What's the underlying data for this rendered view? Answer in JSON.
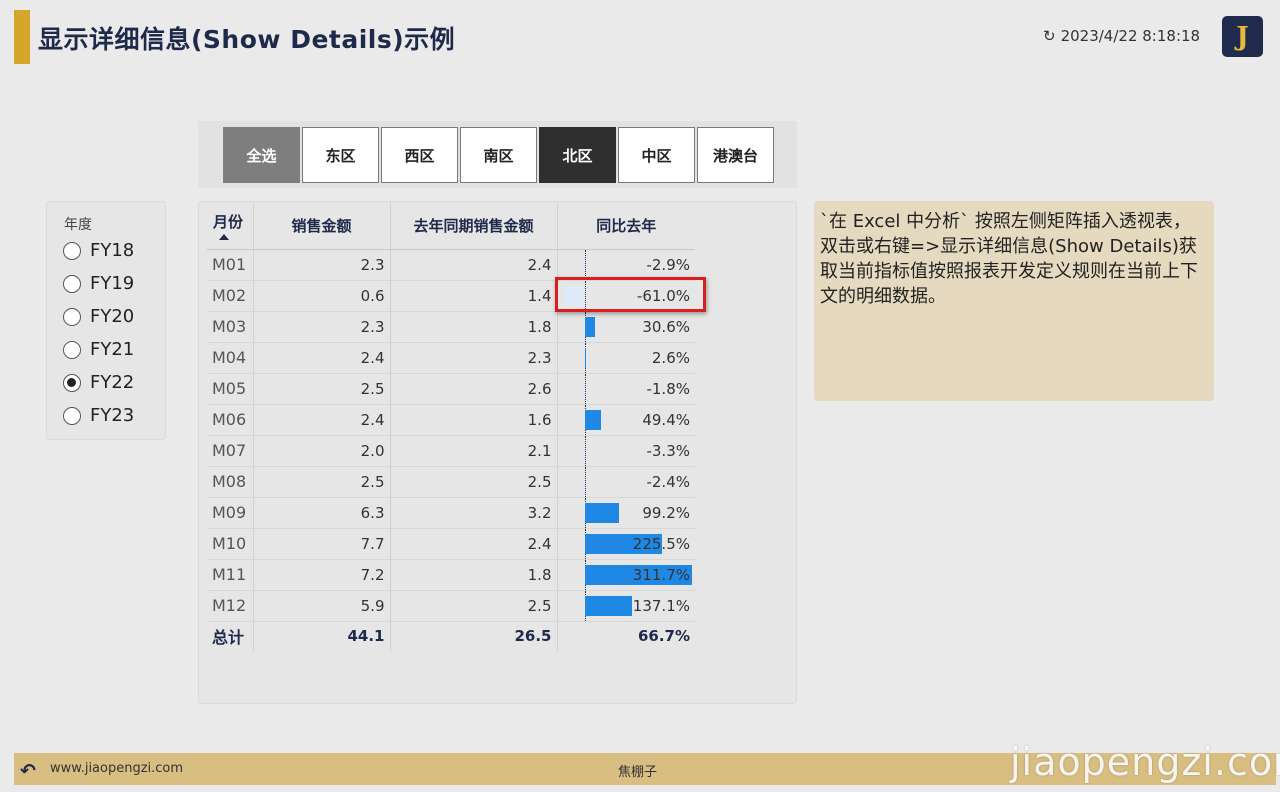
{
  "header": {
    "title": "显示详细信息(Show Details)示例",
    "refresh_icon": "↻",
    "timestamp": "2023/4/22 8:18:18",
    "logo_letter": "J"
  },
  "regions": [
    {
      "label": "全选",
      "state": "all"
    },
    {
      "label": "东区",
      "state": "normal"
    },
    {
      "label": "西区",
      "state": "normal"
    },
    {
      "label": "南区",
      "state": "normal"
    },
    {
      "label": "北区",
      "state": "selected"
    },
    {
      "label": "中区",
      "state": "normal"
    },
    {
      "label": "港澳台",
      "state": "normal"
    }
  ],
  "year_slicer": {
    "label": "年度",
    "options": [
      "FY18",
      "FY19",
      "FY20",
      "FY21",
      "FY22",
      "FY23"
    ],
    "selected": "FY22"
  },
  "table": {
    "headers": [
      "月份",
      "销售金额",
      "去年同期销售金额",
      "同比去年"
    ],
    "sorted_column": "月份",
    "rows": [
      {
        "month": "M01",
        "sales": "2.3",
        "last_year": "2.4",
        "yoy": "-2.9%",
        "yoy_value": -2.9
      },
      {
        "month": "M02",
        "sales": "0.6",
        "last_year": "1.4",
        "yoy": "-61.0%",
        "yoy_value": -61.0
      },
      {
        "month": "M03",
        "sales": "2.3",
        "last_year": "1.8",
        "yoy": "30.6%",
        "yoy_value": 30.6
      },
      {
        "month": "M04",
        "sales": "2.4",
        "last_year": "2.3",
        "yoy": "2.6%",
        "yoy_value": 2.6
      },
      {
        "month": "M05",
        "sales": "2.5",
        "last_year": "2.6",
        "yoy": "-1.8%",
        "yoy_value": -1.8
      },
      {
        "month": "M06",
        "sales": "2.4",
        "last_year": "1.6",
        "yoy": "49.4%",
        "yoy_value": 49.4
      },
      {
        "month": "M07",
        "sales": "2.0",
        "last_year": "2.1",
        "yoy": "-3.3%",
        "yoy_value": -3.3
      },
      {
        "month": "M08",
        "sales": "2.5",
        "last_year": "2.5",
        "yoy": "-2.4%",
        "yoy_value": -2.4
      },
      {
        "month": "M09",
        "sales": "6.3",
        "last_year": "3.2",
        "yoy": "99.2%",
        "yoy_value": 99.2
      },
      {
        "month": "M10",
        "sales": "7.7",
        "last_year": "2.4",
        "yoy": "225.5%",
        "yoy_value": 225.5
      },
      {
        "month": "M11",
        "sales": "7.2",
        "last_year": "1.8",
        "yoy": "311.7%",
        "yoy_value": 311.7
      },
      {
        "month": "M12",
        "sales": "5.9",
        "last_year": "2.5",
        "yoy": "137.1%",
        "yoy_value": 137.1
      }
    ],
    "total": {
      "label": "总计",
      "sales": "44.1",
      "last_year": "26.5",
      "yoy": "66.7%"
    },
    "highlighted_cell": "M02",
    "colors": {
      "positive_bar": "#1f88e5",
      "negative_bar": "#ddeaf7",
      "highlight": "#d62020"
    }
  },
  "note": {
    "text": "`在 Excel 中分析` 按照左侧矩阵插入透视表，双击或右键=>显示详细信息(Show Details)获取当前指标值按照报表开发定义规则在当前上下文的明细数据。"
  },
  "footer": {
    "back_icon": "↶",
    "url": "www.jiaopengzi.com",
    "author": "焦棚子",
    "watermark": "jiaopengzi.com"
  }
}
